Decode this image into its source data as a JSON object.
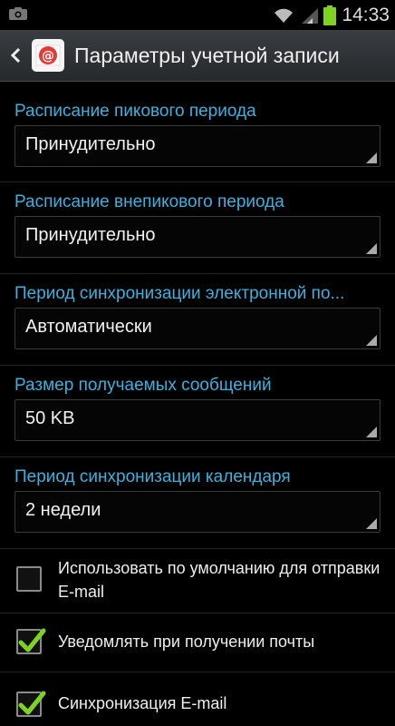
{
  "status_bar": {
    "time": "14:33",
    "icons": [
      "camera-icon",
      "wifi-icon",
      "signal-icon",
      "battery-icon"
    ]
  },
  "header": {
    "title": "Параметры учетной записи",
    "icons": [
      "back-arrow-icon",
      "email-app-icon"
    ]
  },
  "settings": [
    {
      "label": "Расписание пикового периода",
      "value": "Принудительно"
    },
    {
      "label": "Расписание внепикового периода",
      "value": "Принудительно"
    },
    {
      "label": "Период синхронизации электронной по...",
      "value": "Автоматически"
    },
    {
      "label": "Размер получаемых сообщений",
      "value": "50 KB"
    },
    {
      "label": "Период синхронизации календаря",
      "value": "2 недели"
    }
  ],
  "checkboxes": [
    {
      "label": "Использовать по умолчанию для отправки E-mail",
      "checked": false
    },
    {
      "label": "Уведомлять при получении почты",
      "checked": true
    },
    {
      "label": "Синхронизация E-mail",
      "checked": true
    }
  ],
  "colors": {
    "accent": "#3ab2e0",
    "check": "#7ed321",
    "battery": "#7ed321",
    "app_icon": "#e53935"
  }
}
